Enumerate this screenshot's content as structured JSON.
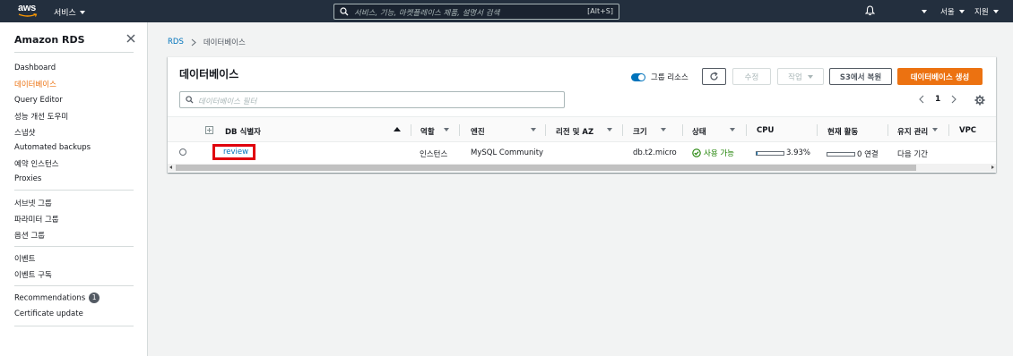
{
  "topnav": {
    "logo_text": "aws",
    "services_label": "서비스",
    "search_placeholder": "서비스, 기능, 마켓플레이스 제품, 설명서 검색",
    "search_shortcut": "[Alt+S]",
    "region_label": "서울",
    "support_label": "지원"
  },
  "sidebar": {
    "title": "Amazon RDS",
    "items": [
      {
        "label": "Dashboard",
        "active": false
      },
      {
        "label": "데이터베이스",
        "active": true
      },
      {
        "label": "Query Editor",
        "active": false
      },
      {
        "label": "성능 개선 도우미",
        "active": false
      },
      {
        "label": "스냅샷",
        "active": false
      },
      {
        "label": "Automated backups",
        "active": false
      },
      {
        "label": "예약 인스턴스",
        "active": false
      },
      {
        "label": "Proxies",
        "active": false
      },
      {
        "label": "서브넷 그룹",
        "active": false
      },
      {
        "label": "파라미터 그룹",
        "active": false
      },
      {
        "label": "옵션 그룹",
        "active": false
      },
      {
        "label": "이벤트",
        "active": false
      },
      {
        "label": "이벤트 구독",
        "active": false
      },
      {
        "label": "Recommendations",
        "active": false,
        "badge": "1"
      },
      {
        "label": "Certificate update",
        "active": false
      }
    ]
  },
  "breadcrumb": {
    "root": "RDS",
    "current": "데이터베이스"
  },
  "panel": {
    "title": "데이터베이스",
    "group_resources_label": "그룹 리소스",
    "group_resources_on": true,
    "modify_label": "수정",
    "actions_label": "작업",
    "restore_s3_label": "S3에서 복원",
    "create_label": "데이터베이스 생성",
    "filter_placeholder": "데이터베이스 필터",
    "page_number": "1"
  },
  "table": {
    "columns": [
      "DB 식별자",
      "역할",
      "엔진",
      "리전 및 AZ",
      "크기",
      "상태",
      "CPU",
      "현재 활동",
      "유지 관리",
      "VPC"
    ],
    "rows": [
      {
        "db_identifier": "review",
        "role": "인스턴스",
        "engine": "MySQL Community",
        "region_az": "",
        "size": "db.t2.micro",
        "status": "사용 가능",
        "cpu": "3.93%",
        "cpu_fraction": 0.0393,
        "activity": "0 연결",
        "activity_fraction": 0,
        "maintenance": "다음 기간",
        "vpc": ""
      }
    ]
  },
  "colors": {
    "nav_bg": "#232f3e",
    "accent_orange": "#ec7211",
    "link_blue": "#0073bb",
    "status_green": "#1d8102",
    "highlight_red": "#e0000d"
  }
}
